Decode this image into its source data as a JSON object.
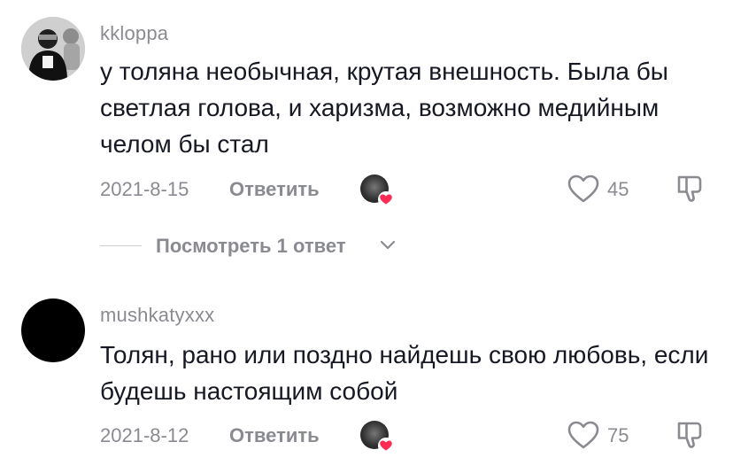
{
  "comments": [
    {
      "username": "kkloppa",
      "text": "у толяна необычная, крутая внешность. Была бы светлая голова, и харизма, возможно медийным челом бы стал",
      "date": "2021-8-15",
      "reply_label": "Ответить",
      "likes": "45",
      "avatar": "profile-photo"
    },
    {
      "username": "mushkatyxxx",
      "text": "Толян, рано или поздно найдешь свою любовь, если будешь настоящим собой",
      "date": "2021-8-12",
      "reply_label": "Ответить",
      "likes": "75",
      "avatar": "black-circle"
    }
  ],
  "view_replies": {
    "label": "Посмотреть 1 ответ"
  },
  "icons": {
    "like": "heart-outline-icon",
    "dislike": "thumb-down-outline-icon",
    "creator_liked": "creator-avatar-with-heart",
    "expand": "chevron-down-icon"
  },
  "colors": {
    "text": "#161823",
    "muted": "#8a8b91",
    "heart": "#fe2c55",
    "separator": "#d0d0d3"
  }
}
